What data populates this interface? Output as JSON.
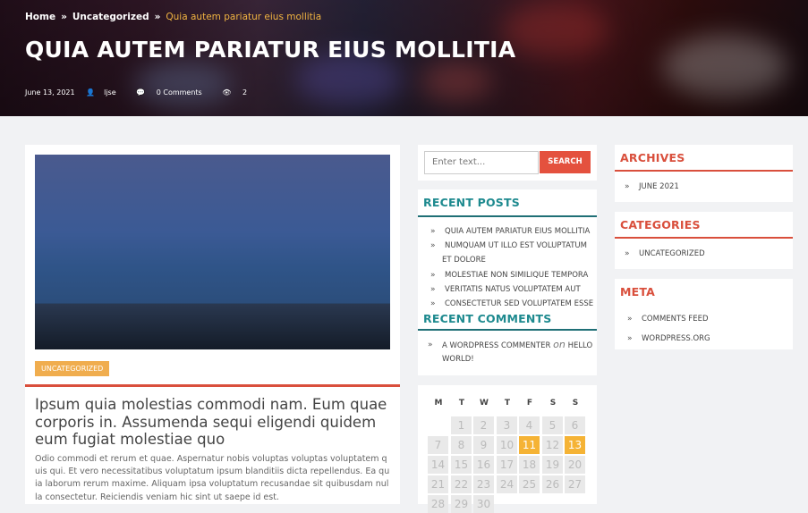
{
  "breadcrumb": {
    "home": "Home",
    "sep": "»",
    "category": "Uncategorized",
    "current": "Quia autem pariatur eius mollitia"
  },
  "hero": {
    "title": "QUIA AUTEM PARIATUR EIUS MOLLITIA",
    "date": "June 13, 2021",
    "author": "ljse",
    "comments": "0 Comments",
    "views": "2"
  },
  "post": {
    "category": "UNCATEGORIZED",
    "title": "Ipsum quia molestias commodi nam. Eum quae corporis in. Assumenda sequi eligendi quidem eum fugiat molestiae quo",
    "excerpt": "Odio commodi et rerum et quae. Aspernatur nobis voluptas voluptas voluptatem quis qui. Et vero necessitatibus voluptatum ipsum blanditiis dicta repellendus. Ea quia laborum rerum maxime. Aliquam ipsa voluptatum recusandae sit quibusdam nulla consectetur. Reiciendis veniam hic sint ut saepe id est."
  },
  "search": {
    "placeholder": "Enter text...",
    "button": "SEARCH"
  },
  "recent_posts": {
    "title": "RECENT POSTS",
    "items": [
      "QUIA AUTEM PARIATUR EIUS MOLLITIA",
      "NUMQUAM UT ILLO EST VOLUPTATUM",
      "ET DOLORE",
      "MOLESTIAE NON SIMILIQUE TEMPORA",
      "VERITATIS NATUS VOLUPTATEM AUT",
      "CONSECTETUR SED VOLUPTATEM ESSE"
    ]
  },
  "recent_comments": {
    "title": "RECENT COMMENTS",
    "author": "A WORDPRESS COMMENTER",
    "on": "on",
    "post_1": "HELLO",
    "post_2": "WORLD!"
  },
  "calendar": {
    "headers": [
      "M",
      "T",
      "W",
      "T",
      "F",
      "S",
      "S"
    ],
    "rows": [
      [
        "",
        "1",
        "2",
        "3",
        "4",
        "5",
        "6"
      ],
      [
        "7",
        "8",
        "9",
        "10",
        "11",
        "12",
        "13"
      ],
      [
        "14",
        "15",
        "16",
        "17",
        "18",
        "19",
        "20"
      ],
      [
        "21",
        "22",
        "23",
        "24",
        "25",
        "26",
        "27"
      ],
      [
        "28",
        "29",
        "30",
        "",
        "",
        "",
        ""
      ]
    ],
    "highlighted": [
      "11",
      "13"
    ]
  },
  "archives": {
    "title": "ARCHIVES",
    "items": [
      "JUNE 2021"
    ]
  },
  "categories": {
    "title": "CATEGORIES",
    "items": [
      "UNCATEGORIZED"
    ]
  },
  "meta": {
    "title": "META",
    "items": [
      "COMMENTS FEED",
      "WORDPRESS.ORG"
    ]
  },
  "colors": {
    "accent_red": "#d94f3c",
    "teal": "#1e8a8f",
    "badge": "#f0ad4e",
    "highlight": "#f5b335"
  }
}
